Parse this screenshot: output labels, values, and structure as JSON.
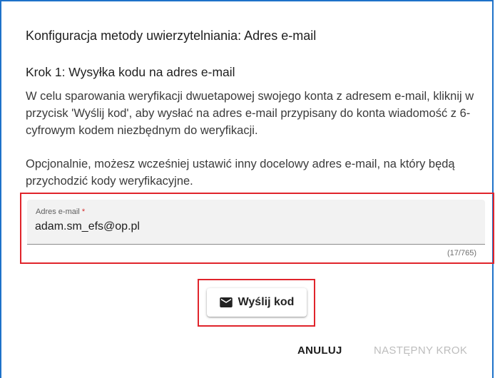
{
  "dialog": {
    "title": "Konfiguracja metody uwierzytelniania: Adres e-mail",
    "step_title": "Krok 1: Wysyłka kodu na adres e-mail",
    "paragraph1": "W celu sparowania weryfikacji dwuetapowej swojego konta z adresem e-mail, kliknij w przycisk 'Wyślij kod', aby wysłać na adres e-mail przypisany do konta wiadomość z 6-cyfrowym kodem niezbędnym do weryfikacji.",
    "paragraph2": "Opcjonalnie, możesz wcześniej ustawić inny docelowy adres e-mail, na który będą przychodzić kody weryfikacyjne."
  },
  "email_field": {
    "label": "Adres e-mail",
    "required_mark": "*",
    "value": "adam.sm_efs@op.pl",
    "counter": "(17/765)"
  },
  "send_button": {
    "label": "Wyślij kod",
    "icon": "mail-icon"
  },
  "footer": {
    "cancel_label": "ANULUJ",
    "next_label": "NASTĘPNY KROK"
  },
  "colors": {
    "highlight": "#e0242b",
    "dialog_border": "#1e72c9",
    "disabled_text": "#bdbdbd"
  }
}
